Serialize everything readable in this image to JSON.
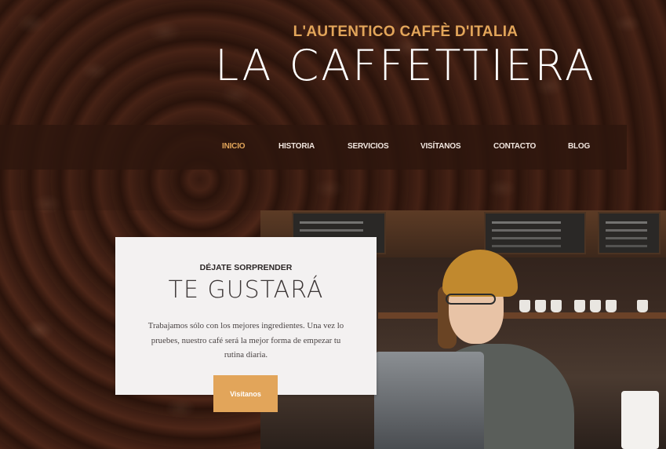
{
  "header": {
    "tagline": "L'AUTENTICO CAFFÈ D'ITALIA",
    "brand": "LA CAFFETTIERA"
  },
  "nav": {
    "items": [
      {
        "label": "INICIO",
        "active": true
      },
      {
        "label": "HISTORIA",
        "active": false
      },
      {
        "label": "SERVICIOS",
        "active": false
      },
      {
        "label": "VISÍTANOS",
        "active": false
      },
      {
        "label": "CONTACTO",
        "active": false
      },
      {
        "label": "BLOG",
        "active": false
      }
    ]
  },
  "feature": {
    "kicker": "DÉJATE SORPRENDER",
    "headline": "TE GUSTARÁ",
    "body": "Trabajamos sólo con los mejores ingredientes. Una vez lo pruebes, nuestro café será la mejor forma de empezar tu rutina diaria.",
    "cta_label": "Visítanos"
  },
  "colors": {
    "accent": "#e2a55a",
    "nav_bar": "#2d160e",
    "card_bg": "#f3f1f1"
  }
}
